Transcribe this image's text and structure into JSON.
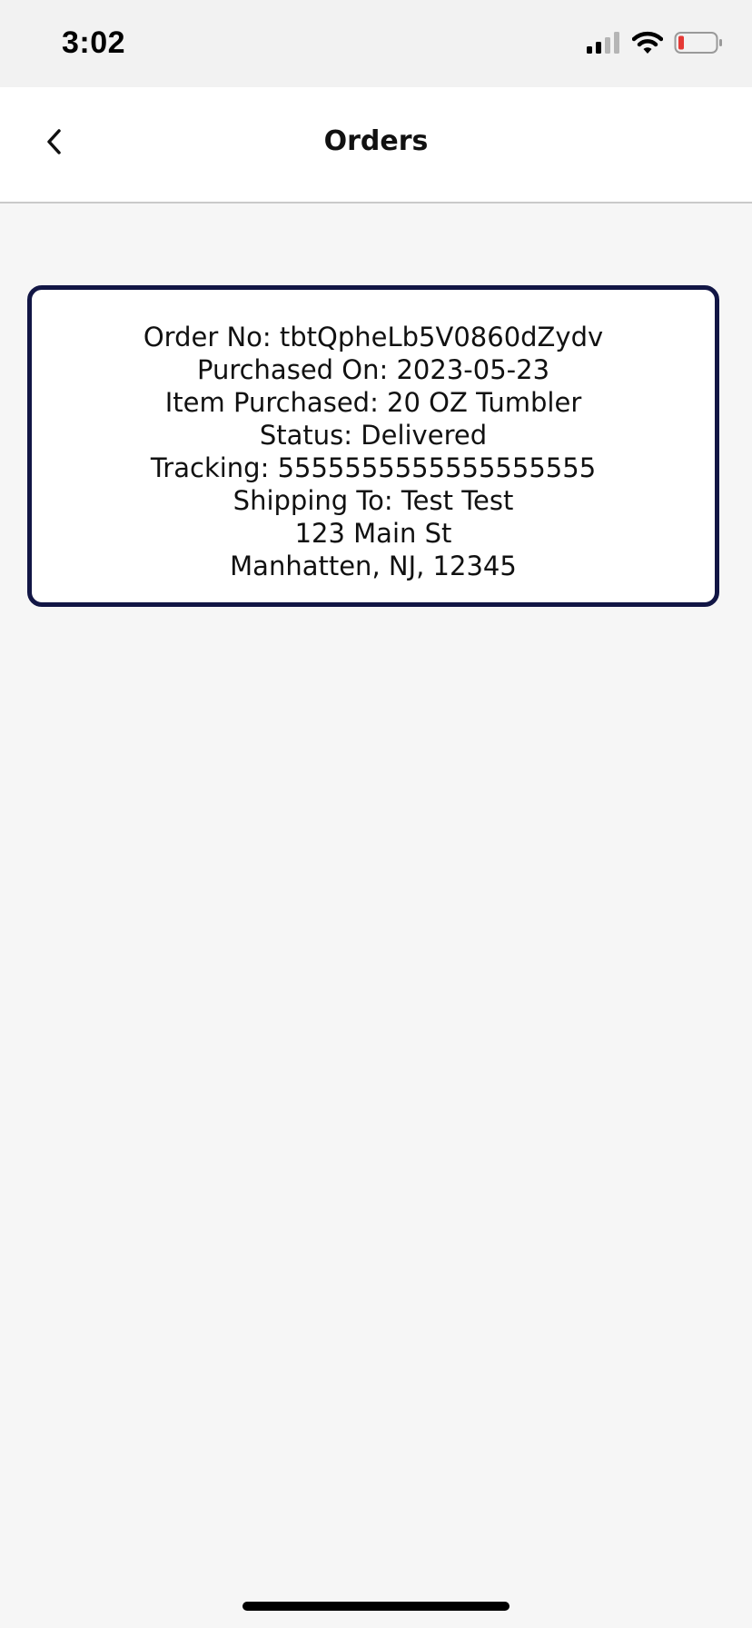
{
  "status_bar": {
    "time": "3:02",
    "icons": [
      "cellular-signal-icon",
      "wifi-icon",
      "battery-low-icon"
    ]
  },
  "nav": {
    "title": "Orders",
    "back_icon": "chevron-left-icon"
  },
  "order": {
    "order_no": "Order No: tbtQpheLb5V0860dZydv",
    "purchased_on": "Purchased On: 2023-05-23",
    "item": "Item Purchased: 20 OZ Tumbler",
    "status": "Status: Delivered",
    "tracking": "Tracking: 5555555555555555555",
    "shipping_to": "Shipping To: Test Test",
    "address_line1": "123 Main St",
    "address_line2": "Manhatten, NJ, 12345"
  },
  "colors": {
    "card_border": "#121645",
    "background": "#f6f6f6",
    "battery_level": "#e53935"
  }
}
